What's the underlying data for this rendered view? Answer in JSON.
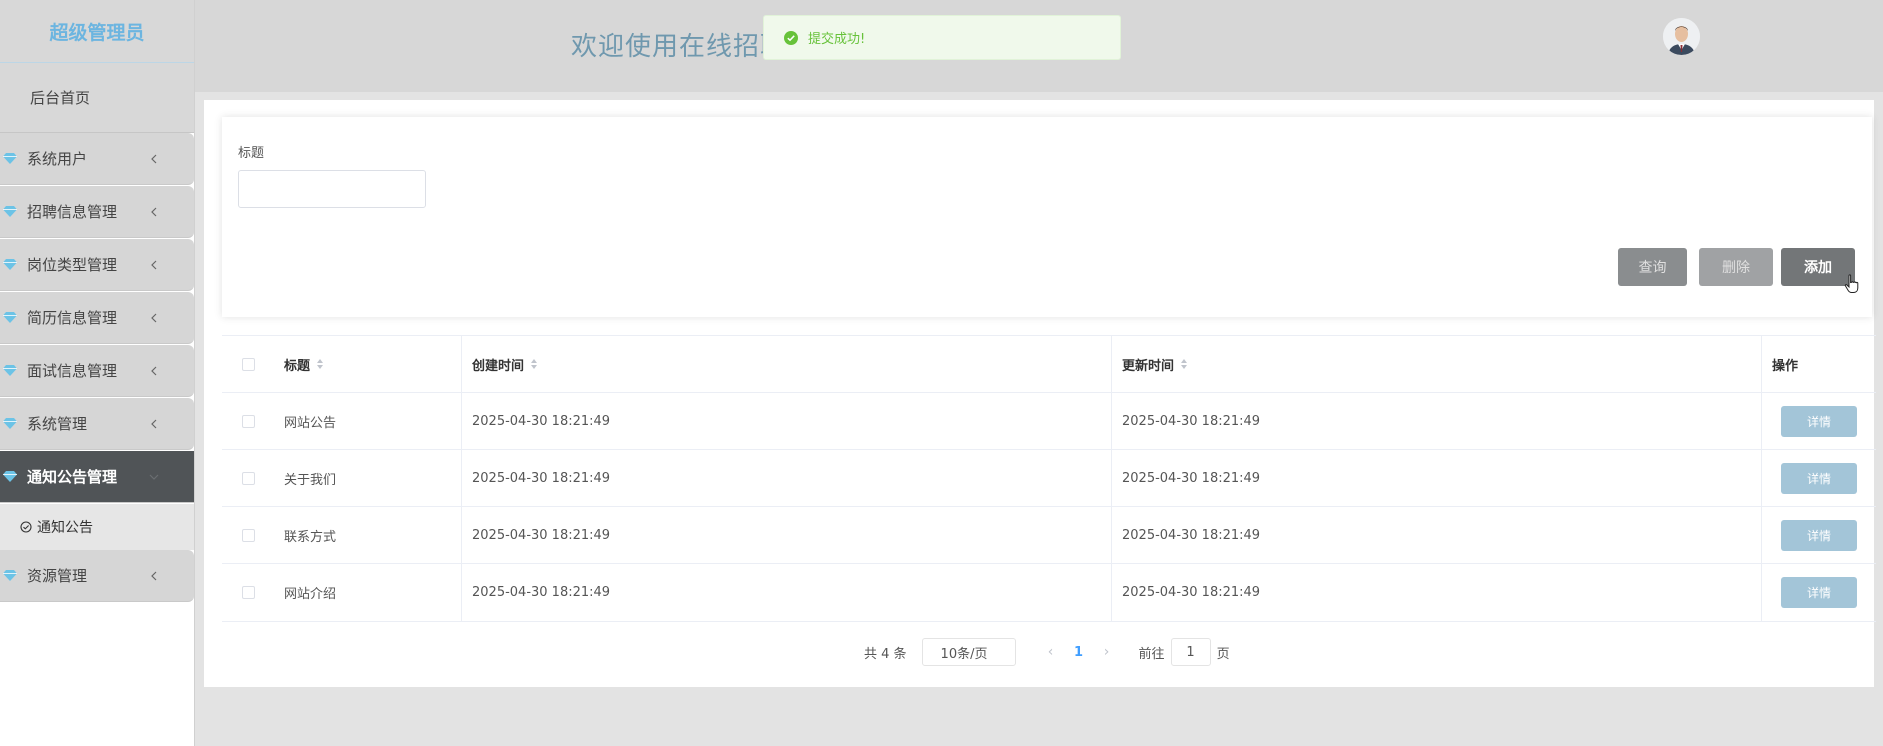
{
  "sidebar": {
    "title": "超级管理员",
    "home": "后台首页",
    "items": [
      {
        "label": "系统用户"
      },
      {
        "label": "招聘信息管理"
      },
      {
        "label": "岗位类型管理"
      },
      {
        "label": "简历信息管理"
      },
      {
        "label": "面试信息管理"
      },
      {
        "label": "系统管理"
      },
      {
        "label": "通知公告管理"
      },
      {
        "label": "资源管理"
      }
    ],
    "active_sub": "通知公告",
    "icon": "gem-icon",
    "accent": "#6cb5e0"
  },
  "header": {
    "title": "欢迎使用在线招聘",
    "avatar_icon": "avatar-icon"
  },
  "toast": {
    "message": "提交成功!",
    "icon": "check-circle-icon",
    "color": "#67c23a"
  },
  "search": {
    "label": "标题",
    "value": "",
    "placeholder": ""
  },
  "buttons": {
    "query": "查询",
    "delete": "删除",
    "add": "添加"
  },
  "table": {
    "columns": {
      "title": "标题",
      "created": "创建时间",
      "updated": "更新时间",
      "op": "操作"
    },
    "rows": [
      {
        "title": "网站公告",
        "created": "2025-04-30 18:21:49",
        "updated": "2025-04-30 18:21:49",
        "action": "详情"
      },
      {
        "title": "关于我们",
        "created": "2025-04-30 18:21:49",
        "updated": "2025-04-30 18:21:49",
        "action": "详情"
      },
      {
        "title": "联系方式",
        "created": "2025-04-30 18:21:49",
        "updated": "2025-04-30 18:21:49",
        "action": "详情"
      },
      {
        "title": "网站介绍",
        "created": "2025-04-30 18:21:49",
        "updated": "2025-04-30 18:21:49",
        "action": "详情"
      }
    ]
  },
  "pagination": {
    "total": "共 4 条",
    "page_size": "10条/页",
    "current": "1",
    "goto_label": "前往",
    "goto_value": "1",
    "page_unit": "页"
  }
}
